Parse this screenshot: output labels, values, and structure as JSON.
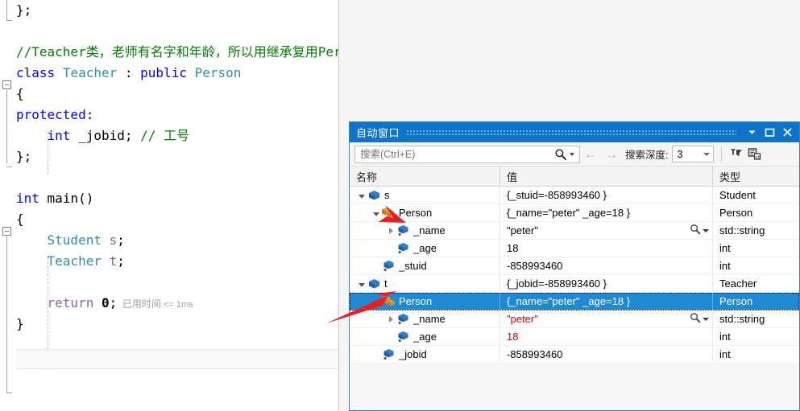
{
  "editor": {
    "lines": [
      {
        "tokens": [
          {
            "t": "};",
            "c": "plain"
          }
        ]
      },
      {
        "tokens": []
      },
      {
        "tokens": [
          {
            "t": "//Teacher类，老师有名字和年龄，所以用继承复用Person的代码",
            "c": "cmt"
          }
        ]
      },
      {
        "tokens": [
          {
            "t": "class",
            "c": "kw"
          },
          {
            "t": " ",
            "c": "plain"
          },
          {
            "t": "Teacher",
            "c": "typ"
          },
          {
            "t": " : ",
            "c": "plain"
          },
          {
            "t": "public",
            "c": "kw"
          },
          {
            "t": " ",
            "c": "plain"
          },
          {
            "t": "Person",
            "c": "typ"
          }
        ]
      },
      {
        "tokens": [
          {
            "t": "{",
            "c": "plain"
          }
        ]
      },
      {
        "tokens": [
          {
            "t": "protected",
            "c": "kw"
          },
          {
            "t": ":",
            "c": "plain"
          }
        ]
      },
      {
        "tokens": [
          {
            "t": "    ",
            "c": "plain"
          },
          {
            "t": "int",
            "c": "kw"
          },
          {
            "t": " _jobid; ",
            "c": "plain"
          },
          {
            "t": "// 工号",
            "c": "cmt"
          }
        ]
      },
      {
        "tokens": [
          {
            "t": "};",
            "c": "plain"
          }
        ]
      },
      {
        "tokens": []
      },
      {
        "tokens": [
          {
            "t": "int",
            "c": "kw"
          },
          {
            "t": " ",
            "c": "plain"
          },
          {
            "t": "main",
            "c": "ident"
          },
          {
            "t": "()",
            "c": "plain"
          }
        ]
      },
      {
        "tokens": [
          {
            "t": "{",
            "c": "plain"
          }
        ]
      },
      {
        "tokens": [
          {
            "t": "    ",
            "c": "plain"
          },
          {
            "t": "Student",
            "c": "typ"
          },
          {
            "t": " ",
            "c": "plain"
          },
          {
            "t": "s",
            "c": "var"
          },
          {
            "t": ";",
            "c": "plain"
          }
        ]
      },
      {
        "tokens": [
          {
            "t": "    ",
            "c": "plain"
          },
          {
            "t": "Teacher",
            "c": "typ"
          },
          {
            "t": " ",
            "c": "plain"
          },
          {
            "t": "t",
            "c": "var"
          },
          {
            "t": ";",
            "c": "plain"
          }
        ]
      },
      {
        "tokens": []
      },
      {
        "tokens": [
          {
            "t": "    ",
            "c": "plain"
          },
          {
            "t": "return",
            "c": "var"
          },
          {
            "t": " ",
            "c": "plain"
          },
          {
            "t": "0",
            "c": "num"
          },
          {
            "t": ";",
            "c": "plain"
          }
        ]
      },
      {
        "tokens": [
          {
            "t": "}",
            "c": "plain"
          }
        ]
      }
    ],
    "elapsed_label": "已用时间",
    "elapsed_value": "<= 1ms"
  },
  "autos": {
    "title": "自动窗口",
    "titlebar_buttons": [
      {
        "name": "window-menu",
        "glyph": "▼"
      },
      {
        "name": "maximize",
        "glyph": "❐"
      },
      {
        "name": "close",
        "glyph": "✕"
      }
    ],
    "toolbar": {
      "search_placeholder": "搜索(Ctrl+E)",
      "search_value": "",
      "back_glyph": "←",
      "forward_glyph": "→",
      "depth_label": "搜索深度:",
      "depth_value": "3"
    },
    "columns": {
      "name": "名称",
      "value": "值",
      "type": "类型"
    },
    "rows": [
      {
        "indent": 0,
        "twisty": "open",
        "icon": "local-var",
        "name": "s",
        "value": "{_stuid=-858993460 }",
        "type": "Student",
        "selected": false,
        "value_changed": false,
        "has_visualizer": false
      },
      {
        "indent": 1,
        "twisty": "open",
        "icon": "base-class",
        "name": "Person",
        "value": "{_name=\"peter\" _age=18 }",
        "type": "Person",
        "selected": false,
        "value_changed": false,
        "has_visualizer": false
      },
      {
        "indent": 2,
        "twisty": "closed",
        "icon": "field",
        "name": "_name",
        "value": "\"peter\"",
        "type": "std::string",
        "selected": false,
        "value_changed": false,
        "has_visualizer": true
      },
      {
        "indent": 2,
        "twisty": "none",
        "icon": "field",
        "name": "_age",
        "value": "18",
        "type": "int",
        "selected": false,
        "value_changed": false,
        "has_visualizer": false
      },
      {
        "indent": 1,
        "twisty": "none",
        "icon": "field",
        "name": "_stuid",
        "value": "-858993460",
        "type": "int",
        "selected": false,
        "value_changed": false,
        "has_visualizer": false
      },
      {
        "indent": 0,
        "twisty": "open",
        "icon": "local-var",
        "name": "t",
        "value": "{_jobid=-858993460 }",
        "type": "Teacher",
        "selected": false,
        "value_changed": false,
        "has_visualizer": false
      },
      {
        "indent": 1,
        "twisty": "open",
        "icon": "base-class",
        "name": "Person",
        "value": "{_name=\"peter\" _age=18 }",
        "type": "Person",
        "selected": true,
        "value_changed": false,
        "has_visualizer": false
      },
      {
        "indent": 2,
        "twisty": "closed",
        "icon": "field",
        "name": "_name",
        "value": "\"peter\"",
        "type": "std::string",
        "selected": false,
        "value_changed": true,
        "has_visualizer": true
      },
      {
        "indent": 2,
        "twisty": "none",
        "icon": "field",
        "name": "_age",
        "value": "18",
        "type": "int",
        "selected": false,
        "value_changed": true,
        "has_visualizer": false
      },
      {
        "indent": 1,
        "twisty": "none",
        "icon": "field",
        "name": "_jobid",
        "value": "-858993460",
        "type": "int",
        "selected": false,
        "value_changed": false,
        "has_visualizer": false
      }
    ]
  },
  "annotations": {
    "arrow_color": "#f01c1c",
    "arrows": [
      {
        "name": "arrow-pointing-to-s-person-row"
      },
      {
        "name": "arrow-pointing-to-t-person-row"
      }
    ]
  },
  "colors": {
    "accent": "#0d74c8",
    "selection": "#1e8ad6",
    "comment": "#008000",
    "keyword": "#0000ff",
    "type": "#2b91af",
    "changed_value": "#d40000"
  }
}
